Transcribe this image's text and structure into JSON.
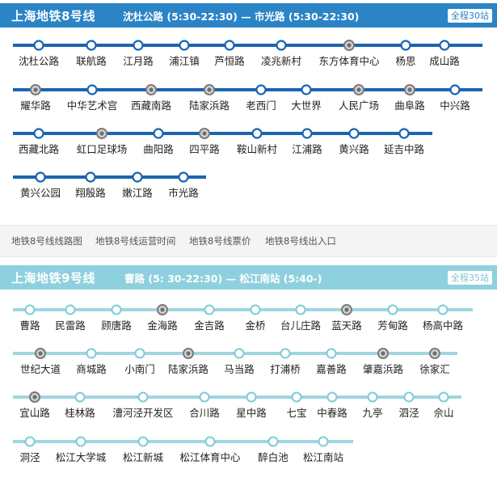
{
  "line8": {
    "title": "上海地铁8号线",
    "hours": "沈杜公路 (5:30-22:30)  —  市光路 (5:30-22:30)",
    "badge": "全程30站",
    "color": "#2a84c6",
    "track_color": "#1b64b0",
    "rows": [
      [
        {
          "name": "沈杜公路",
          "transfer": false
        },
        {
          "name": "联航路",
          "transfer": false
        },
        {
          "name": "江月路",
          "transfer": false
        },
        {
          "name": "浦江镇",
          "transfer": false
        },
        {
          "name": "芦恒路",
          "transfer": false
        },
        {
          "name": "凌兆新村",
          "transfer": false
        },
        {
          "name": "东方体育中心",
          "transfer": true
        },
        {
          "name": "杨思",
          "transfer": false
        },
        {
          "name": "成山路",
          "transfer": false
        }
      ],
      [
        {
          "name": "耀华路",
          "transfer": true
        },
        {
          "name": "中华艺术宫",
          "transfer": false
        },
        {
          "name": "西藏南路",
          "transfer": true
        },
        {
          "name": "陆家浜路",
          "transfer": true
        },
        {
          "name": "老西门",
          "transfer": false
        },
        {
          "name": "大世界",
          "transfer": false
        },
        {
          "name": "人民广场",
          "transfer": true
        },
        {
          "name": "曲阜路",
          "transfer": true
        },
        {
          "name": "中兴路",
          "transfer": false
        }
      ],
      [
        {
          "name": "西藏北路",
          "transfer": false
        },
        {
          "name": "虹口足球场",
          "transfer": true
        },
        {
          "name": "曲阳路",
          "transfer": false
        },
        {
          "name": "四平路",
          "transfer": true
        },
        {
          "name": "鞍山新村",
          "transfer": false
        },
        {
          "name": "江浦路",
          "transfer": false
        },
        {
          "name": "黄兴路",
          "transfer": false
        },
        {
          "name": "延吉中路",
          "transfer": false
        }
      ],
      [
        {
          "name": "黄兴公园",
          "transfer": false
        },
        {
          "name": "翔殷路",
          "transfer": false
        },
        {
          "name": "嫩江路",
          "transfer": false
        },
        {
          "name": "市光路",
          "transfer": false
        }
      ]
    ]
  },
  "links": [
    "地铁8号线线路图",
    "地铁8号线运营时间",
    "地铁8号线票价",
    "地铁8号线出入口"
  ],
  "line9": {
    "title": "上海地铁9号线",
    "hours": "曹路 (5: 30-22:30)  —  松江南站 (5:40-)",
    "badge": "全程35站",
    "color": "#8fd0de",
    "track_color": "#9fd6df",
    "rows": [
      [
        {
          "name": "曹路",
          "transfer": false
        },
        {
          "name": "民雷路",
          "transfer": false
        },
        {
          "name": "顾唐路",
          "transfer": false
        },
        {
          "name": "金海路",
          "transfer": true
        },
        {
          "name": "金吉路",
          "transfer": false
        },
        {
          "name": "金桥",
          "transfer": false
        },
        {
          "name": "台儿庄路",
          "transfer": false
        },
        {
          "name": "蓝天路",
          "transfer": true
        },
        {
          "name": "芳甸路",
          "transfer": false
        },
        {
          "name": "杨高中路",
          "transfer": false
        }
      ],
      [
        {
          "name": "世纪大道",
          "transfer": true
        },
        {
          "name": "商城路",
          "transfer": false
        },
        {
          "name": "小南门",
          "transfer": false
        },
        {
          "name": "陆家浜路",
          "transfer": true
        },
        {
          "name": "马当路",
          "transfer": false
        },
        {
          "name": "打浦桥",
          "transfer": false
        },
        {
          "name": "嘉善路",
          "transfer": false
        },
        {
          "name": "肇嘉浜路",
          "transfer": true
        },
        {
          "name": "徐家汇",
          "transfer": true
        }
      ],
      [
        {
          "name": "宜山路",
          "transfer": true
        },
        {
          "name": "桂林路",
          "transfer": false
        },
        {
          "name": "漕河泾开发区",
          "transfer": false
        },
        {
          "name": "合川路",
          "transfer": false
        },
        {
          "name": "星中路",
          "transfer": false
        },
        {
          "name": "七宝",
          "transfer": false
        },
        {
          "name": "中春路",
          "transfer": false
        },
        {
          "name": "九亭",
          "transfer": false
        },
        {
          "name": "泗泾",
          "transfer": false
        },
        {
          "name": "佘山",
          "transfer": false
        }
      ],
      [
        {
          "name": "洞泾",
          "transfer": false
        },
        {
          "name": "松江大学城",
          "transfer": false
        },
        {
          "name": "松江新城",
          "transfer": false
        },
        {
          "name": "松江体育中心",
          "transfer": false
        },
        {
          "name": "醉白池",
          "transfer": false
        },
        {
          "name": "松江南站",
          "transfer": false
        }
      ]
    ]
  }
}
